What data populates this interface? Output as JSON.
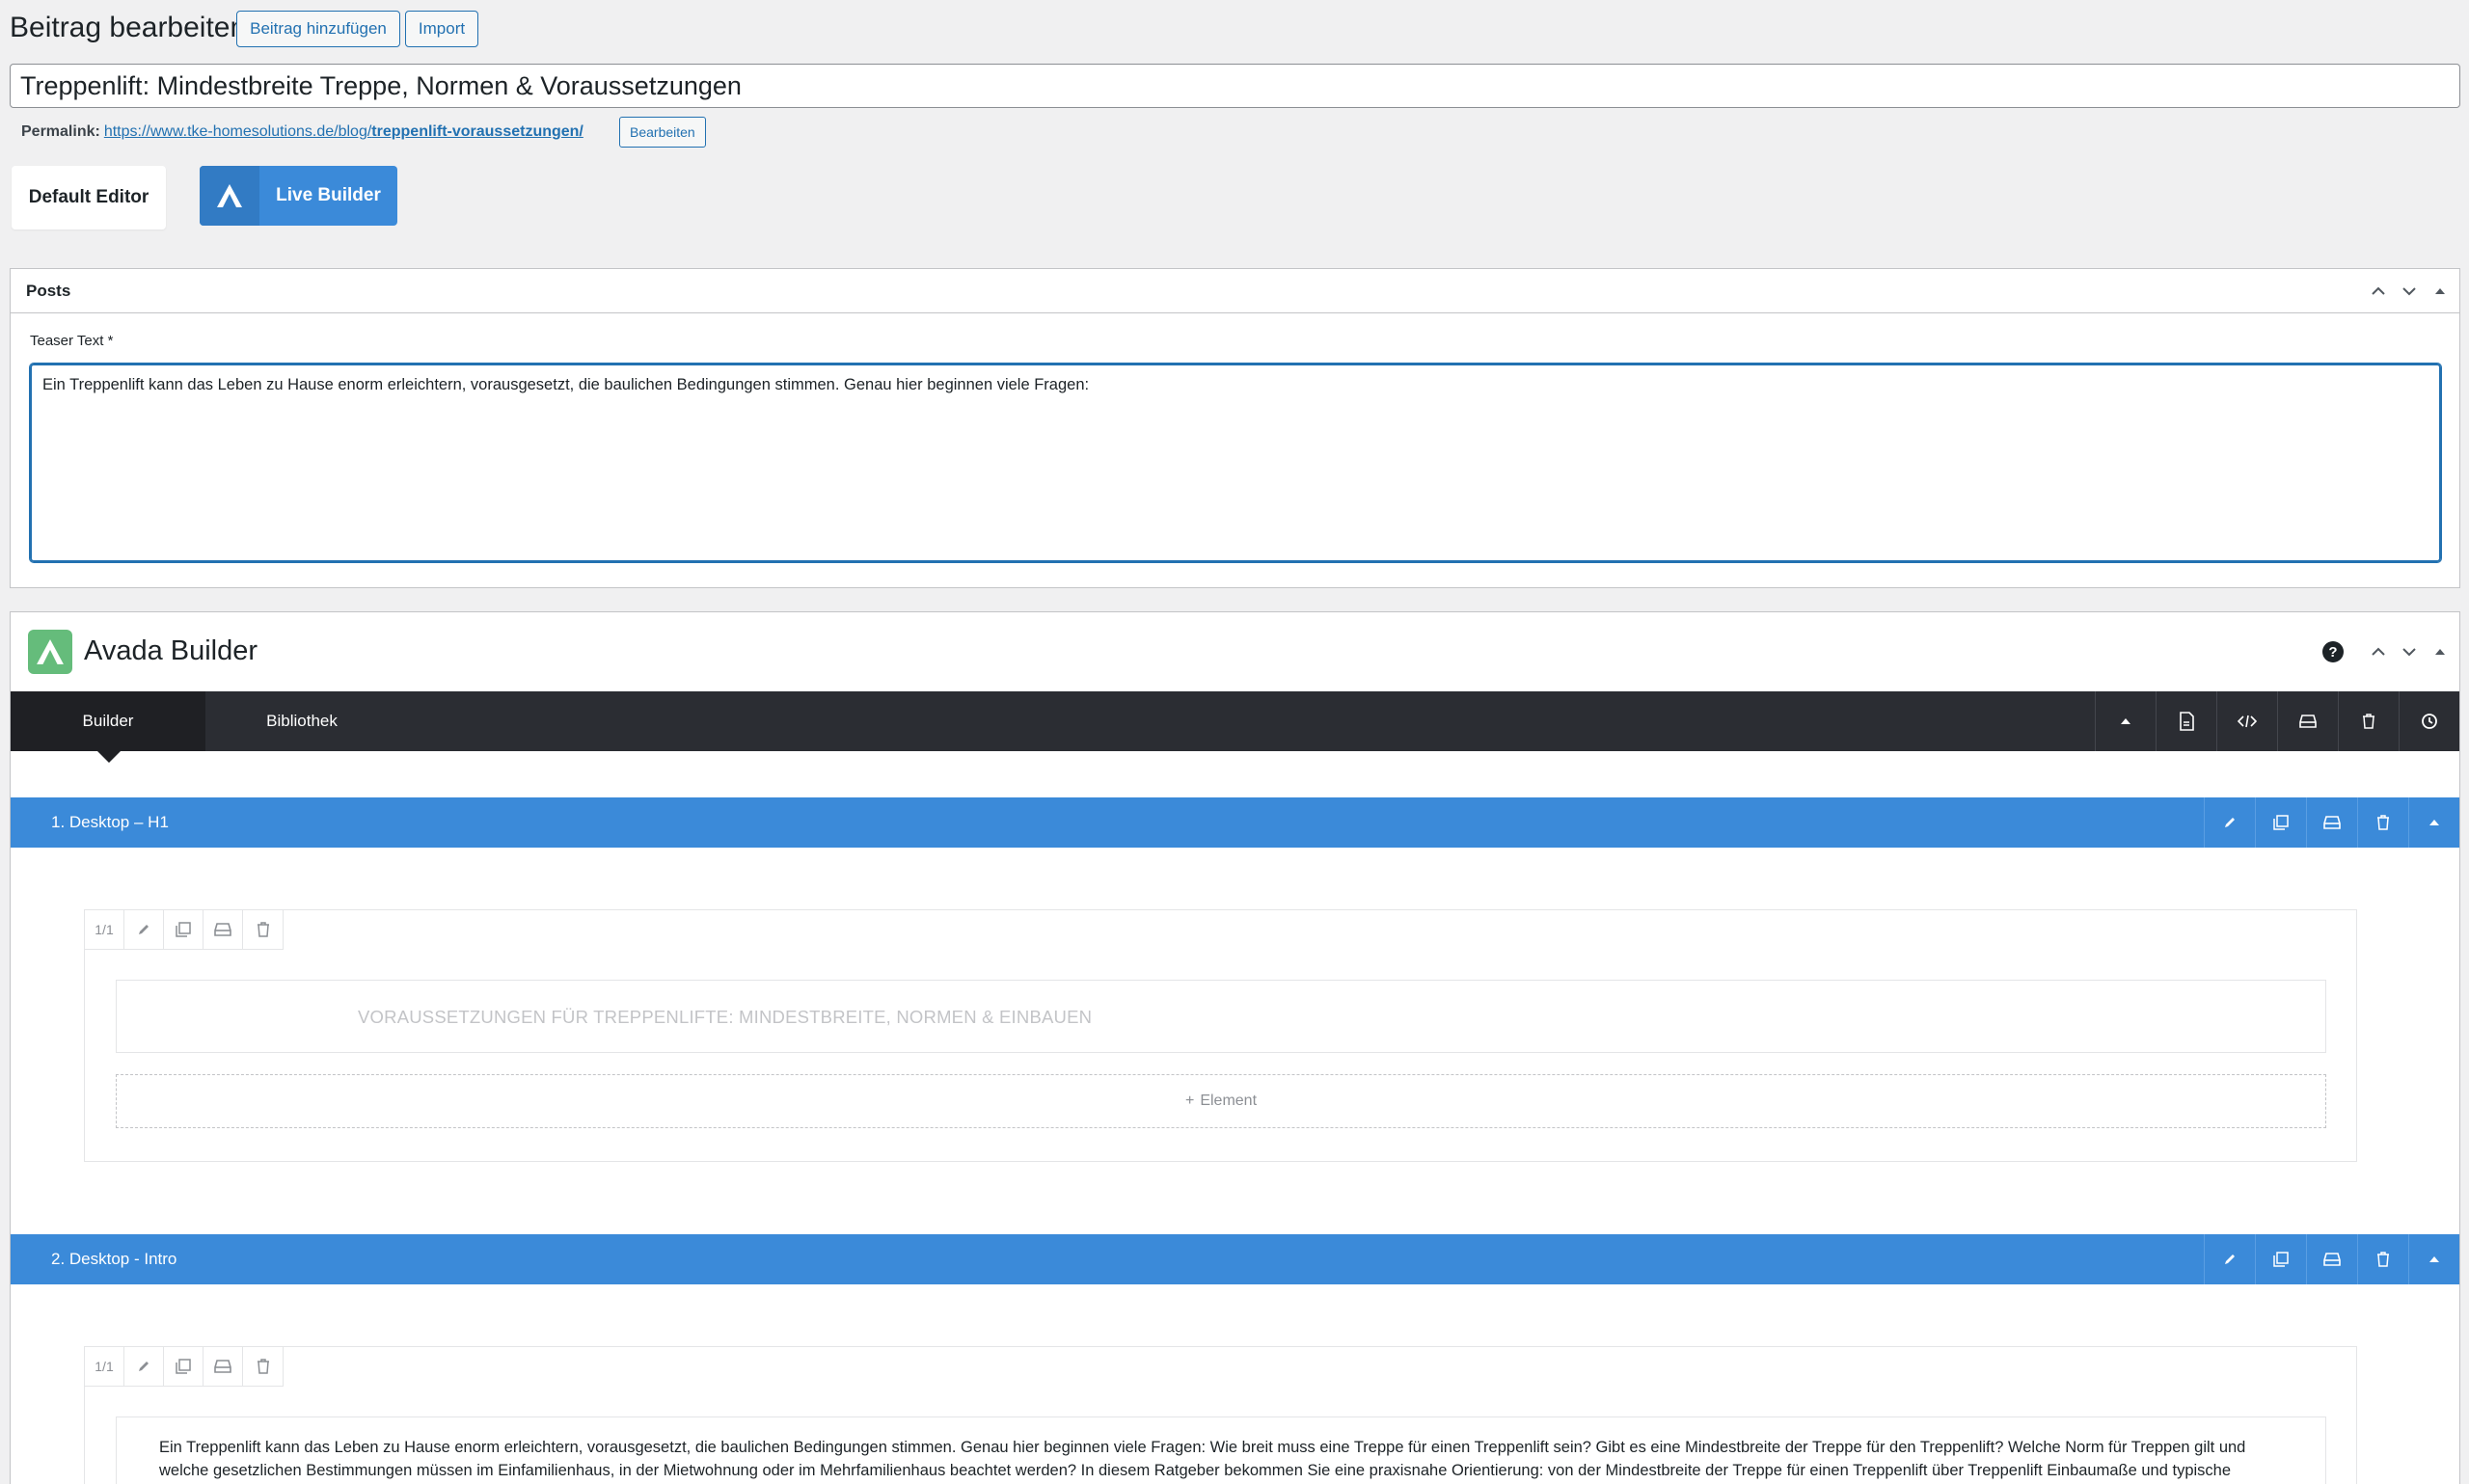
{
  "header": {
    "title": "Beitrag bearbeiten",
    "add_button": "Beitrag hinzufügen",
    "import_button": "Import"
  },
  "post": {
    "title": "Treppenlift: Mindestbreite Treppe, Normen & Voraussetzungen",
    "permalink_label": "Permalink:",
    "permalink_base": "https://www.tke-homesolutions.de/blog/",
    "permalink_slug": "treppenlift-voraussetzungen/",
    "permalink_edit": "Bearbeiten"
  },
  "editor_switch": {
    "default_editor": "Default Editor",
    "live_builder": "Live Builder"
  },
  "posts_panel": {
    "title": "Posts",
    "teaser_label": "Teaser Text *",
    "teaser_value": "Ein Treppenlift kann das Leben zu Hause enorm erleichtern, vorausgesetzt, die baulichen Bedingungen stimmen. Genau hier beginnen viele Fragen:"
  },
  "avada": {
    "title": "Avada Builder",
    "help": "?",
    "tabs": [
      "Builder",
      "Bibliothek"
    ],
    "containers": [
      {
        "title": "1. Desktop – H1",
        "column_size": "1/1",
        "element_text": "VORAUSSETZUNGEN FÜR TREPPENLIFTE: MINDESTBREITE, NORMEN & EINBAUEN",
        "add_element": "Element"
      },
      {
        "title": "2. Desktop - Intro",
        "column_size": "1/1",
        "element_text": "Ein Treppenlift kann das Leben zu Hause enorm erleichtern, vorausgesetzt, die baulichen Bedingungen stimmen. Genau hier beginnen viele Fragen: Wie breit muss eine Treppe für einen Treppenlift sein? Gibt es eine Mindestbreite der Treppe für den Treppenlift? Welche Norm für Treppen gilt und welche gesetzlichen Bestimmungen müssen im Einfamilienhaus, in der Mietwohnung oder im Mehrfamilienhaus beachtet werden? In diesem Ratgeber bekommen Sie eine praxisnahe Orientierung: von der Mindestbreite der Treppe für einen Treppenlift über Treppenlift Einbaumaße und typische"
      }
    ]
  },
  "colors": {
    "wp_blue": "#2271b1",
    "avada_blue": "#3b8ad9",
    "avada_green": "#65bc7b",
    "dark_bar": "#2b2d33"
  }
}
